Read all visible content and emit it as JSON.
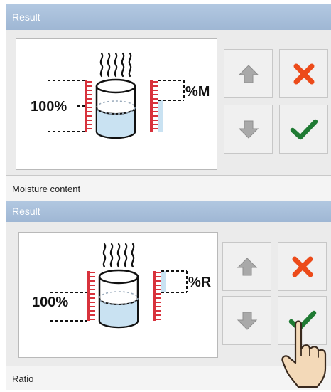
{
  "screen1": {
    "title": "Result",
    "indicator_percent_label": "100%",
    "indicator_result_label": "%M",
    "footer_label": "Moisture content"
  },
  "screen2": {
    "title": "Result",
    "indicator_percent_label": "100%",
    "indicator_result_label": "%R",
    "footer_label": "Ratio"
  },
  "colors": {
    "title_bar": "#a8bfda",
    "scale_red": "#d8323c",
    "liquid_blue": "#c9e2f2",
    "cancel_red": "#ec4b1a",
    "confirm_green": "#1f7a33",
    "arrow_gray": "#a9a9a9"
  },
  "icons": {
    "up": "arrow-up-icon",
    "down": "arrow-down-icon",
    "cancel": "cross-icon",
    "confirm": "checkmark-icon",
    "touch": "hand-pointer-icon"
  }
}
